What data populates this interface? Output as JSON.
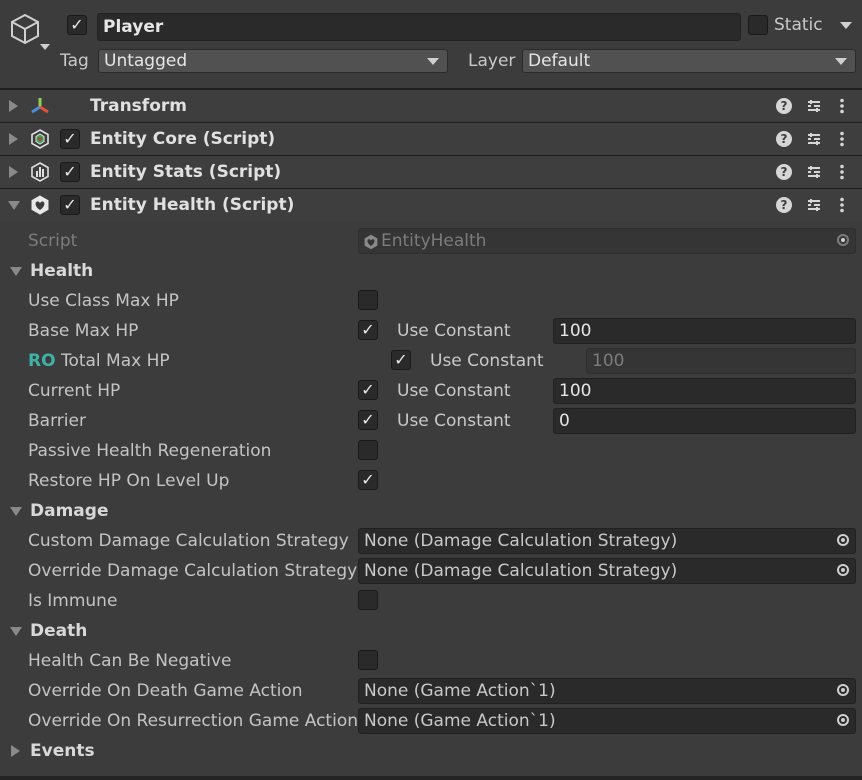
{
  "header": {
    "object_name": "Player",
    "active": true,
    "static_label": "Static",
    "static_checked": false,
    "tag_label": "Tag",
    "tag_value": "Untagged",
    "layer_label": "Layer",
    "layer_value": "Default"
  },
  "components": [
    {
      "name": "Transform",
      "icon": "transform-icon",
      "enabled": null,
      "expanded": false
    },
    {
      "name": "Entity Core (Script)",
      "icon": "entity-core-icon",
      "enabled": true,
      "expanded": false
    },
    {
      "name": "Entity Stats (Script)",
      "icon": "entity-stats-icon",
      "enabled": true,
      "expanded": false
    },
    {
      "name": "Entity Health (Script)",
      "icon": "entity-health-icon",
      "enabled": true,
      "expanded": true
    }
  ],
  "script": {
    "label": "Script",
    "value": "EntityHealth"
  },
  "health": {
    "title": "Health",
    "use_class_max_hp": {
      "label": "Use Class Max HP",
      "checked": false
    },
    "base_max_hp": {
      "label": "Base Max HP",
      "use_constant": "Use Constant",
      "value": "100"
    },
    "total_max_hp": {
      "ro": "RO",
      "label": "Total Max HP",
      "use_constant": "Use Constant",
      "value": "100"
    },
    "current_hp": {
      "label": "Current HP",
      "use_constant": "Use Constant",
      "value": "100"
    },
    "barrier": {
      "label": "Barrier",
      "use_constant": "Use Constant",
      "value": "0"
    },
    "passive_regen": {
      "label": "Passive Health Regeneration",
      "checked": false
    },
    "restore_on_level_up": {
      "label": "Restore HP On Level Up",
      "checked": true
    }
  },
  "damage": {
    "title": "Damage",
    "custom_strategy": {
      "label": "Custom Damage Calculation Strategy",
      "value": "None (Damage Calculation Strategy)"
    },
    "override_strategy": {
      "label": "Override Damage Calculation Strategy",
      "value": "None (Damage Calculation Strategy)"
    },
    "is_immune": {
      "label": "Is Immune",
      "checked": false
    }
  },
  "death": {
    "title": "Death",
    "can_be_negative": {
      "label": "Health Can Be Negative",
      "checked": false
    },
    "on_death": {
      "label": "Override On Death Game Action",
      "value": "None (Game Action`1)"
    },
    "on_resurrection": {
      "label": "Override On Resurrection Game Action",
      "value": "None (Game Action`1)"
    }
  },
  "events": {
    "title": "Events"
  },
  "colors": {
    "background": "#3c3c3c",
    "field": "#2a2a2a",
    "ro_accent": "#3fb2a6"
  }
}
